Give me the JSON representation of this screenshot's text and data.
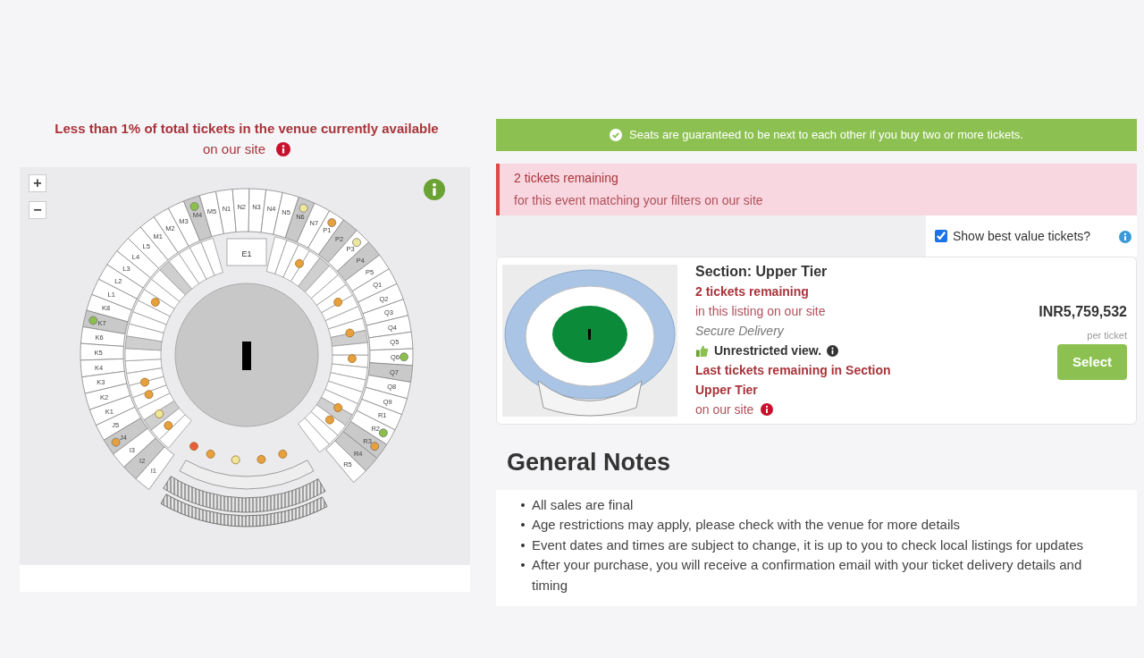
{
  "availability": {
    "headline": "Less than 1% of total tickets in the venue currently available",
    "subline": "on our site"
  },
  "map": {
    "zoom_in": "+",
    "zoom_out": "−",
    "inner_label": "E1",
    "left_sections": [
      {
        "label": "K8",
        "highlighted": false
      },
      {
        "label": "K7",
        "highlighted": true,
        "color": "#8cbf4a"
      },
      {
        "label": "K6",
        "highlighted": false
      },
      {
        "label": "K5",
        "highlighted": false
      },
      {
        "label": "K4",
        "highlighted": false
      },
      {
        "label": "K3",
        "highlighted": false
      },
      {
        "label": "K2",
        "highlighted": false
      },
      {
        "label": "K1",
        "highlighted": false
      },
      {
        "label": "J5",
        "highlighted": false
      },
      {
        "label": "J4",
        "highlighted": true,
        "color": "#e8a03c"
      },
      {
        "label": "I3",
        "highlighted": false
      },
      {
        "label": "I2",
        "highlighted": true
      },
      {
        "label": "I1",
        "highlighted": false
      }
    ],
    "top_sections": [
      {
        "label": "L1",
        "highlighted": false
      },
      {
        "label": "L2",
        "highlighted": false
      },
      {
        "label": "L3",
        "highlighted": false
      },
      {
        "label": "L4",
        "highlighted": false
      },
      {
        "label": "L5",
        "highlighted": false
      },
      {
        "label": "M1",
        "highlighted": false
      },
      {
        "label": "M2",
        "highlighted": false
      },
      {
        "label": "M3",
        "highlighted": false
      },
      {
        "label": "M4",
        "highlighted": true,
        "color": "#8cbf4a"
      },
      {
        "label": "M5",
        "highlighted": false
      },
      {
        "label": "N1",
        "highlighted": false
      },
      {
        "label": "N2",
        "highlighted": false
      },
      {
        "label": "N3",
        "highlighted": false
      },
      {
        "label": "N4",
        "highlighted": false
      },
      {
        "label": "N5",
        "highlighted": false
      },
      {
        "label": "N6",
        "highlighted": true,
        "color": "#eee79a"
      },
      {
        "label": "N7",
        "highlighted": false
      },
      {
        "label": "P1",
        "highlighted": false,
        "color": "#e8a03c"
      },
      {
        "label": "P2",
        "highlighted": true
      },
      {
        "label": "P3",
        "highlighted": false,
        "color": "#eee79a"
      },
      {
        "label": "P4",
        "highlighted": true
      },
      {
        "label": "P5",
        "highlighted": false
      }
    ],
    "right_sections": [
      {
        "label": "Q1",
        "highlighted": false
      },
      {
        "label": "Q2",
        "highlighted": false
      },
      {
        "label": "Q3",
        "highlighted": false
      },
      {
        "label": "Q4",
        "highlighted": false
      },
      {
        "label": "Q5",
        "highlighted": false
      },
      {
        "label": "Q6",
        "highlighted": false,
        "color": "#8cbf4a"
      },
      {
        "label": "Q7",
        "highlighted": true
      },
      {
        "label": "Q8",
        "highlighted": false
      },
      {
        "label": "Q9",
        "highlighted": false
      },
      {
        "label": "R1",
        "highlighted": false
      },
      {
        "label": "R2",
        "highlighted": false,
        "color": "#8cbf4a"
      },
      {
        "label": "R3",
        "highlighted": true,
        "color": "#e8a03c"
      },
      {
        "label": "R4",
        "highlighted": true
      },
      {
        "label": "R5",
        "highlighted": false
      }
    ]
  },
  "guarantee_banner": "Seats are guaranteed to be next to each other if you buy two or more tickets.",
  "remaining_alert": {
    "title": "2 tickets remaining",
    "text": "for this event matching your filters on our site"
  },
  "best_value": {
    "label": "Show best value tickets?",
    "checked": true
  },
  "listing": {
    "section": "Section: Upper Tier",
    "remaining": "2 tickets remaining",
    "remaining_note": "in this listing on our site",
    "delivery": "Secure Delivery",
    "view": "Unrestricted view.",
    "last_tickets": "Last tickets remaining in Section Upper Tier",
    "last_note": "on our site",
    "price": "INR5,759,532",
    "price_unit": "per ticket",
    "select": "Select"
  },
  "general_notes": {
    "title": "General Notes",
    "items": [
      "All sales are final",
      "Age restrictions may apply, please check with the venue for more details",
      "Event dates and times are subject to change, it is up to you to check local listings for updates",
      "After your purchase, you will receive a confirmation email with your ticket delivery details and timing"
    ]
  }
}
